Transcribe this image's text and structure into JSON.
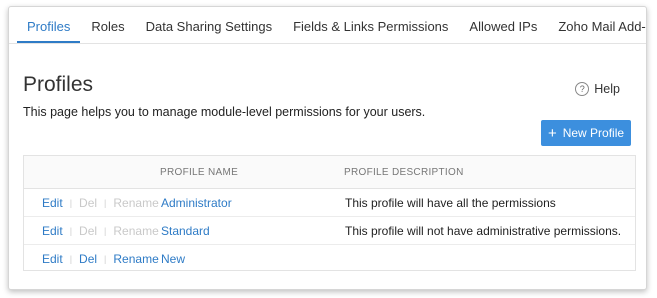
{
  "tabs": [
    "Profiles",
    "Roles",
    "Data Sharing Settings",
    "Fields & Links Permissions",
    "Allowed IPs",
    "Zoho Mail Add-on Users"
  ],
  "active_tab": "Profiles",
  "page": {
    "title": "Profiles",
    "description": "This page helps you to manage module-level permissions for your users.",
    "help_label": "Help",
    "new_profile_label": "New Profile"
  },
  "table": {
    "headers": {
      "name": "PROFILE NAME",
      "description": "PROFILE DESCRIPTION"
    },
    "rows": [
      {
        "edit": "Edit",
        "del": "Del",
        "rename": "Rename",
        "name": "Administrator",
        "description": "This profile will have all the permissions"
      },
      {
        "edit": "Edit",
        "del": "Del",
        "rename": "Rename",
        "name": "Standard",
        "description": "This profile will not have administrative permissions."
      },
      {
        "edit": "Edit",
        "del": "Del",
        "rename": "Rename",
        "name": "New",
        "description": ""
      }
    ]
  },
  "colors": {
    "accent": "#2e7bc6",
    "button": "#3c8fde",
    "disabled": "#c9c9c9"
  },
  "icons": {
    "help": "question-circle-icon",
    "add": "plus-icon"
  }
}
